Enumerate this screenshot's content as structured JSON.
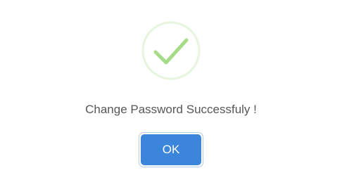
{
  "dialog": {
    "icon": "checkmark-success-icon",
    "message": "Change Password Successfuly !",
    "ok_label": "OK"
  },
  "colors": {
    "check": "#a5dc86",
    "ring": "#e7f4de",
    "button": "#3b86db",
    "button_focus_ring": "#b6cce3",
    "text": "#575757"
  }
}
